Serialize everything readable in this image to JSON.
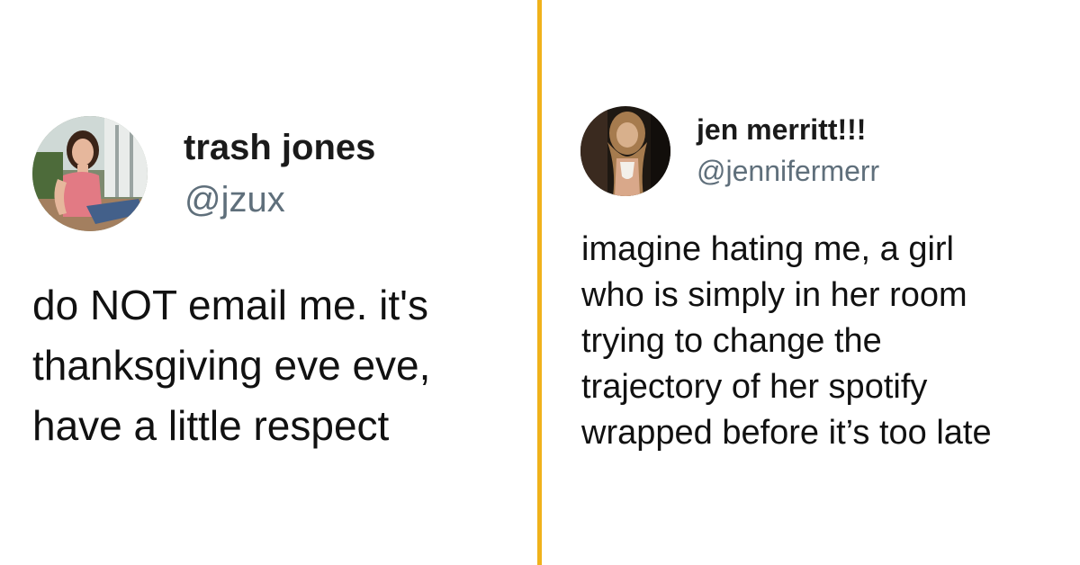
{
  "tweets": [
    {
      "avatar_icon": "user-photo-icon",
      "name": "trash jones",
      "handle": "@jzux",
      "text_lines": [
        "do NOT email me. it's",
        "thanksgiving eve eve,",
        "have a little respect"
      ]
    },
    {
      "avatar_icon": "user-photo-icon",
      "name": "jen merritt!!!",
      "handle": "@jennifermerr",
      "text_lines": [
        "imagine hating me, a girl",
        "who is simply in her room",
        "trying to change the",
        "trajectory of her spotify",
        "wrapped before it’s too late"
      ]
    }
  ],
  "colors": {
    "divider": "#f0b21b",
    "handle": "#5f6f7b",
    "text": "#111111"
  }
}
